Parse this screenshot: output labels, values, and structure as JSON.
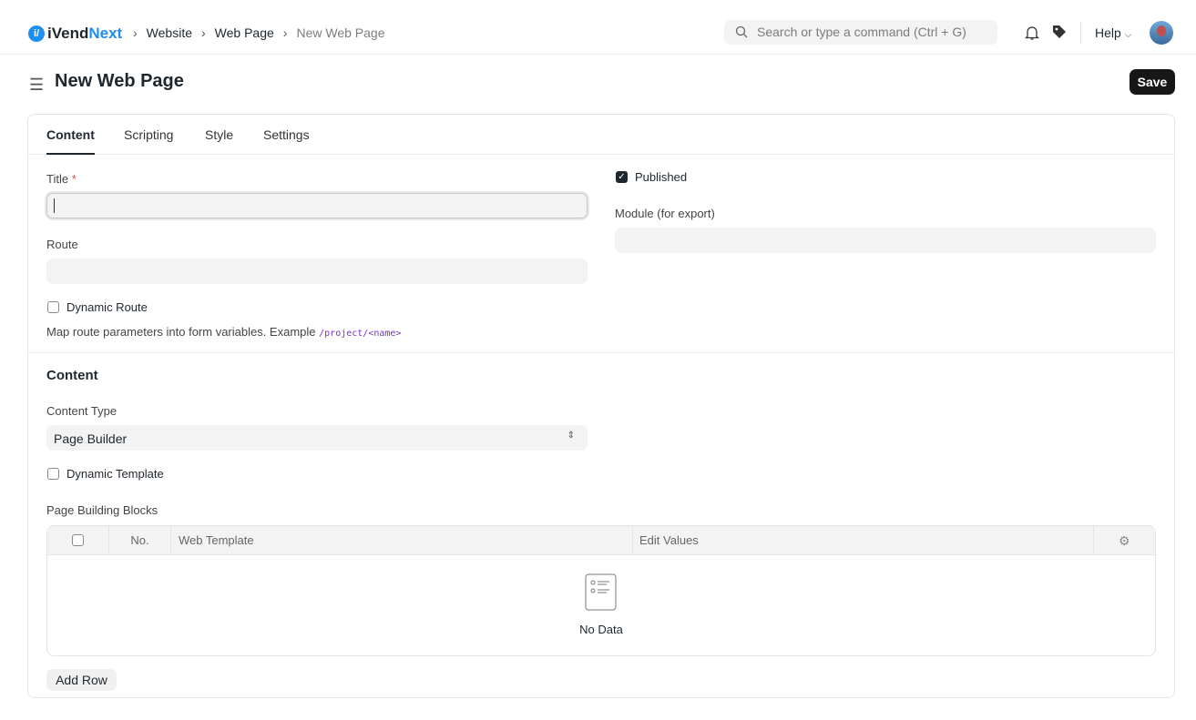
{
  "brand": {
    "name_a": "iVend",
    "name_b": "Next",
    "logo_glyph": "i/"
  },
  "breadcrumbs": [
    "Website",
    "Web Page",
    "New Web Page"
  ],
  "search": {
    "placeholder": "Search or type a command (Ctrl + G)"
  },
  "help_label": "Help",
  "page": {
    "title": "New Web Page",
    "save_label": "Save"
  },
  "tabs": [
    "Content",
    "Scripting",
    "Style",
    "Settings"
  ],
  "fields": {
    "title_label": "Title",
    "required_mark": "*",
    "title_value": "",
    "route_label": "Route",
    "route_value": "",
    "dynamic_route_label": "Dynamic Route",
    "dynamic_route_checked": false,
    "route_help": "Map route parameters into form variables. Example ",
    "route_help_code": "/project/<name>",
    "published_label": "Published",
    "published_checked": true,
    "module_label": "Module (for export)",
    "module_value": ""
  },
  "content_section": {
    "heading": "Content",
    "content_type_label": "Content Type",
    "content_type_value": "Page Builder",
    "dynamic_template_label": "Dynamic Template",
    "dynamic_template_checked": false,
    "blocks_label": "Page Building Blocks",
    "columns": [
      "No.",
      "Web Template",
      "Edit Values"
    ],
    "empty_text": "No Data",
    "add_row_label": "Add Row"
  }
}
